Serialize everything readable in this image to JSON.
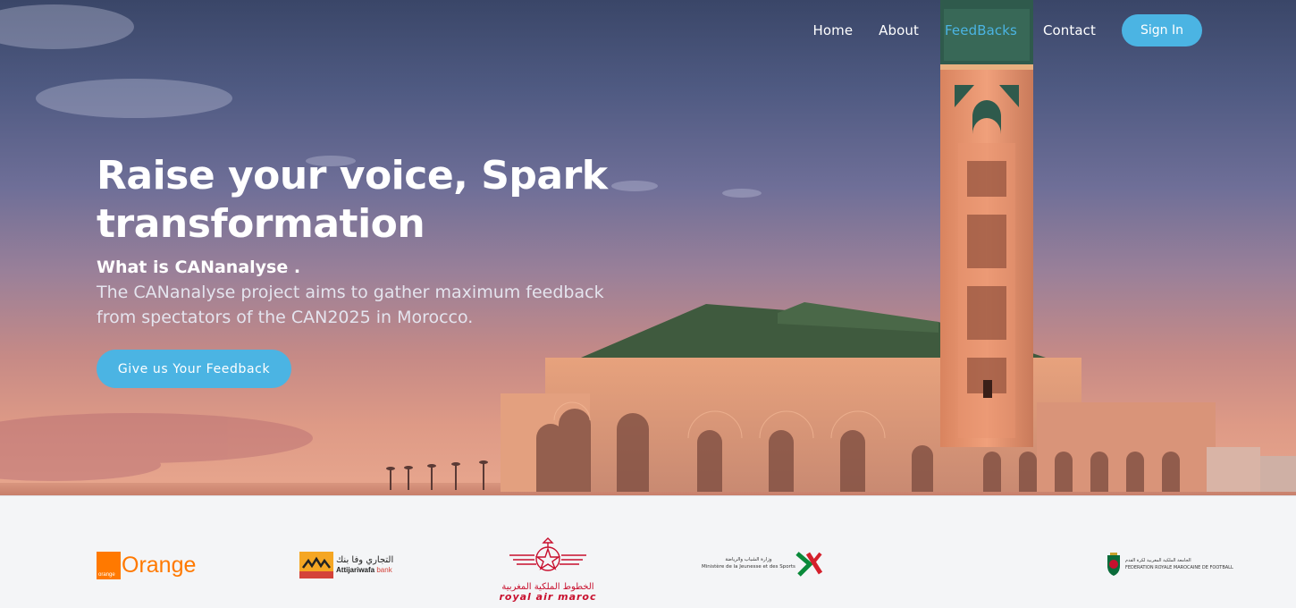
{
  "nav": {
    "items": [
      {
        "label": "Home",
        "active": false
      },
      {
        "label": "About",
        "active": false
      },
      {
        "label": "FeedBacks",
        "active": true
      },
      {
        "label": "Contact",
        "active": false
      }
    ],
    "signin_label": "Sign In"
  },
  "hero": {
    "title": "Raise your voice, Spark transformation",
    "subtitle": "What is CANanalyse .",
    "description": "The CANanalyse project aims to gather maximum feedback from spectators of the CAN2025 in Morocco.",
    "cta_label": "Give us Your Feedback",
    "background_image": "hassan-ii-mosque-sunset"
  },
  "sponsors": {
    "orange": {
      "badge": "orange",
      "word": "Orange",
      "color": "#ff7900"
    },
    "attijariwafa": {
      "arabic": "التجاري وفا بنك",
      "name": "Attijariwafa",
      "suffix": "bank"
    },
    "royal_air_maroc": {
      "arabic": "الخطوط الملكية المغربية",
      "name": "royal air maroc",
      "color": "#c8102e"
    },
    "ministry": {
      "arabic": "وزارة الشباب والرياضة",
      "name": "Ministère de la Jeunesse et des Sports"
    },
    "frmf": {
      "arabic": "الجامعة الملكية المغربية لكرة القدم",
      "name": "FEDERATION ROYALE MAROCAINE DE FOOTBALL"
    }
  },
  "colors": {
    "accent": "#4bb4e3",
    "footer_bg": "#f4f5f7"
  }
}
